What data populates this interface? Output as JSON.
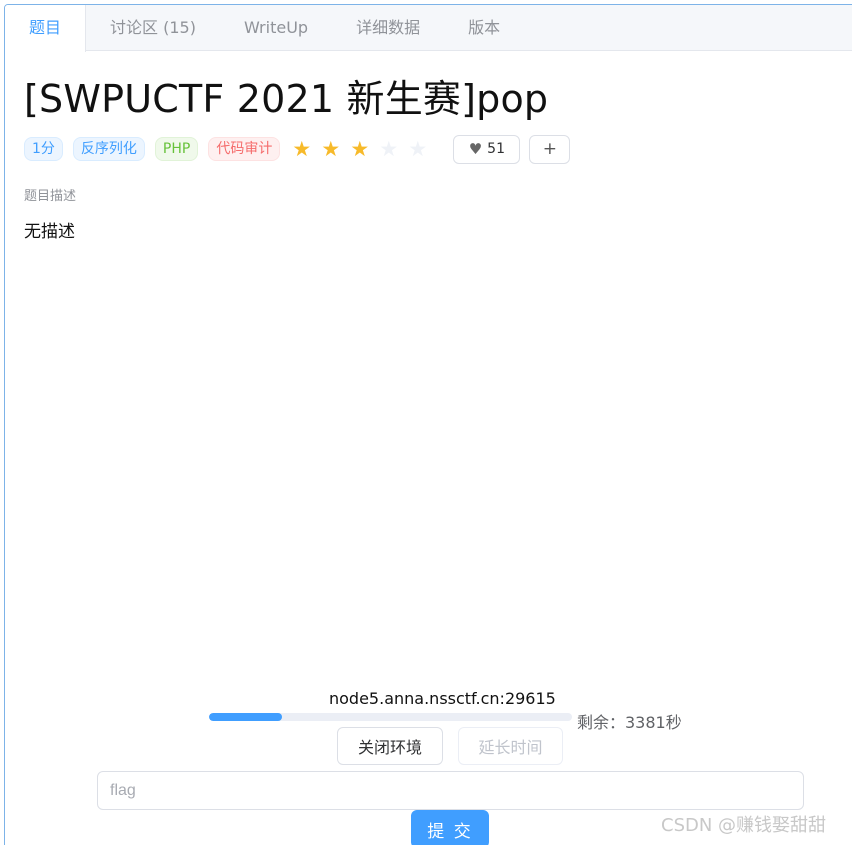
{
  "tabs": [
    {
      "label": "题目"
    },
    {
      "label": "讨论区 (15)"
    },
    {
      "label": "WriteUp"
    },
    {
      "label": "详细数据"
    },
    {
      "label": "版本"
    }
  ],
  "problem": {
    "title": "[SWPUCTF 2021 新生赛]pop",
    "tags": [
      {
        "label": "1分",
        "color": "#409eff"
      },
      {
        "label": "反序列化",
        "color": "#409eff"
      },
      {
        "label": "PHP",
        "color": "#67c23a"
      },
      {
        "label": "代码审计",
        "color": "#f56c6c"
      }
    ],
    "rating": {
      "value": 3,
      "max": 5
    },
    "likes": "51",
    "plus_label": "+",
    "description_label": "题目描述",
    "description": "无描述"
  },
  "instance": {
    "host": "node5.anna.nssctf.cn:29615",
    "progress_fraction": 0.2,
    "remaining": "剩余：3381秒",
    "close_label": "关闭环境",
    "extend_label": "延长时间"
  },
  "flag": {
    "placeholder": "flag",
    "value": "",
    "submit_label": "提 交"
  },
  "watermark": "CSDN @赚钱娶甜甜",
  "colors": {
    "accent": "#409eff",
    "star_on": "#f7ba2a",
    "star_off": "#eff2f7"
  }
}
